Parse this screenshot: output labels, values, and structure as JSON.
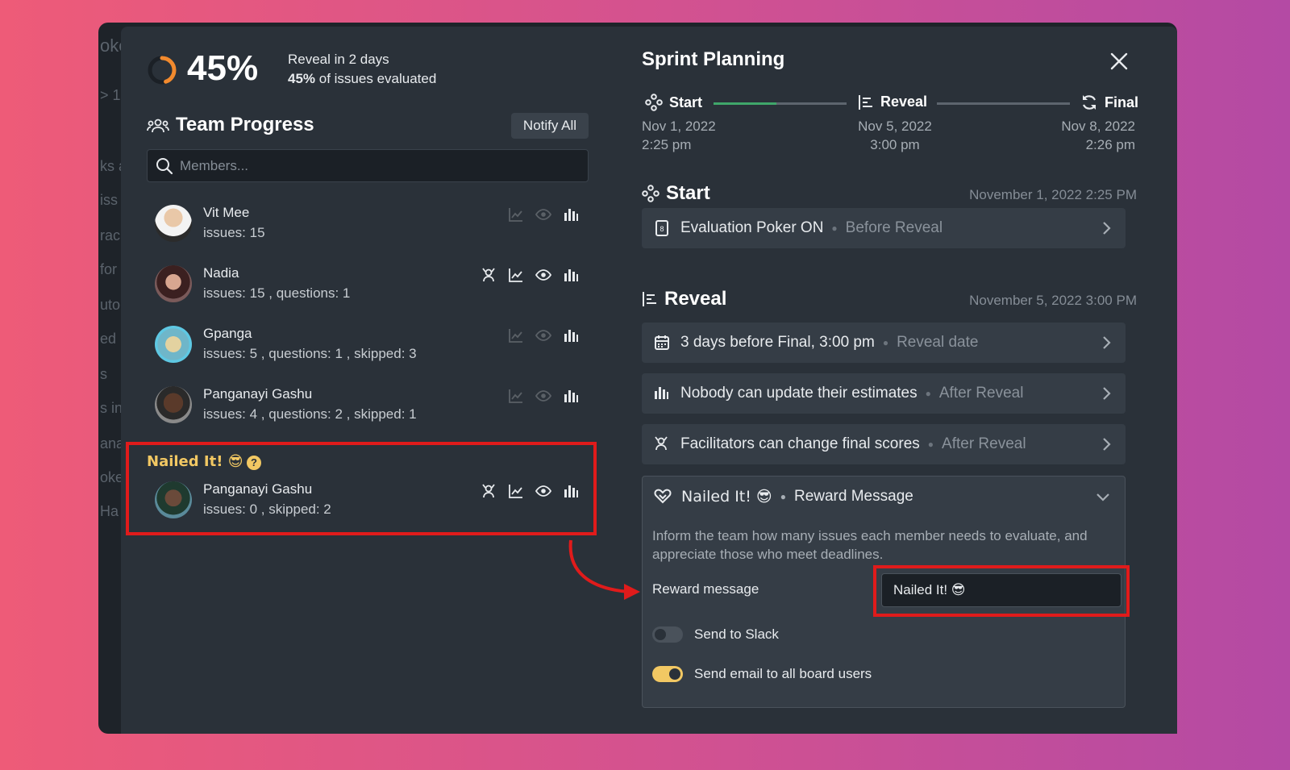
{
  "progress": {
    "percent_value": 45,
    "percent_text": "45%",
    "reveal_in": "Reveal in 2 days",
    "evaluated_pct": "45%",
    "evaluated_text": " of issues evaluated"
  },
  "team": {
    "title": "Team Progress",
    "notify_label": "Notify All",
    "search_placeholder": "Members...",
    "members": [
      {
        "name": "Vit Mee",
        "stats": "issues: 15"
      },
      {
        "name": "Nadia",
        "stats": "issues: 15 , questions: 1"
      },
      {
        "name": "Gpanga",
        "stats": "issues: 5 , questions: 1 , skipped: 3"
      },
      {
        "name": "Panganayi Gashu",
        "stats": "issues: 4 , questions: 2 , skipped: 1"
      }
    ],
    "nailed": {
      "title": "Nailed It! 😎",
      "help": "?",
      "member": {
        "name": "Panganayi Gashu",
        "stats": "issues: 0 , skipped: 2"
      }
    }
  },
  "sprint": {
    "title": "Sprint Planning",
    "timeline": {
      "start": {
        "label": "Start",
        "date": "Nov 1, 2022",
        "time": "2:25 pm"
      },
      "reveal": {
        "label": "Reveal",
        "date": "Nov 5, 2022",
        "time": "3:00 pm"
      },
      "final": {
        "label": "Final",
        "date": "Nov 8, 2022",
        "time": "2:26 pm"
      }
    },
    "start_section": {
      "title": "Start",
      "date": "November 1, 2022 2:25 PM",
      "row": {
        "main": "Evaluation Poker ON",
        "muted": "Before Reveal"
      }
    },
    "reveal_section": {
      "title": "Reveal",
      "date": "November 5, 2022 3:00 PM",
      "rows": [
        {
          "main": "3 days before Final, 3:00 pm",
          "muted": "Reveal date"
        },
        {
          "main": "Nobody can update their estimates",
          "muted": "After Reveal"
        },
        {
          "main": "Facilitators can change final scores",
          "muted": "After Reveal"
        }
      ]
    },
    "reward": {
      "title": "Nailed It! 😎",
      "subtitle": "Reward Message",
      "description": "Inform the team how many issues each member needs to evaluate, and appreciate those who meet deadlines.",
      "label": "Reward message",
      "value": "Nailed It! 😎",
      "slack_label": "Send to Slack",
      "slack_on": false,
      "email_label": "Send email to all board users",
      "email_on": true
    }
  },
  "colors": {
    "accent": "#f2c863",
    "progress_green": "#3fa66a",
    "highlight_red": "#e01b1b"
  },
  "background_strip": [
    "oke",
    "> 1",
    "ks a",
    "iss",
    "rack",
    "for",
    "uto",
    "ed I",
    "s",
    "s in",
    "ana",
    "oke",
    "Ha"
  ]
}
